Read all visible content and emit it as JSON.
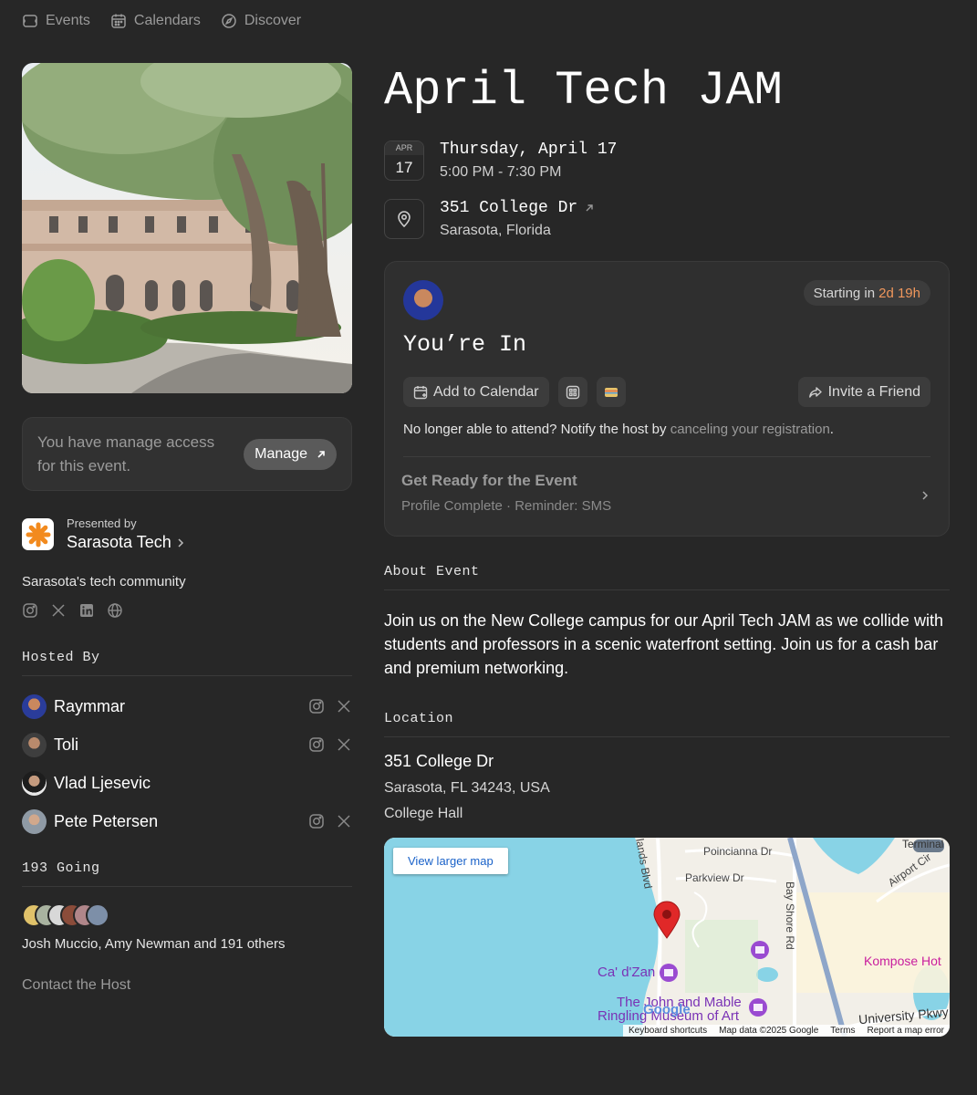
{
  "nav": {
    "events": "Events",
    "calendars": "Calendars",
    "discover": "Discover"
  },
  "manage": {
    "text": "You have manage access for this event.",
    "button": "Manage"
  },
  "presenter": {
    "label": "Presented by",
    "name": "Sarasota Tech",
    "description": "Sarasota's tech community"
  },
  "hosted_by": {
    "title": "Hosted By",
    "hosts": [
      {
        "name": "Raymmar"
      },
      {
        "name": "Toli"
      },
      {
        "name": "Vlad Ljesevic"
      },
      {
        "name": "Pete Petersen"
      }
    ]
  },
  "going": {
    "title": "193 Going",
    "names": "Josh Muccio, Amy Newman and 191 others"
  },
  "contact": "Contact the Host",
  "event": {
    "title": "April Tech JAM",
    "month": "APR",
    "day": "17",
    "date": "Thursday, April 17",
    "time": "5:00 PM - 7:30 PM",
    "address": "351 College Dr",
    "city": "Sarasota, Florida"
  },
  "card": {
    "starting_label": "Starting in",
    "starting_value": "2d 19h",
    "status": "You’re In",
    "add_calendar": "Add to Calendar",
    "invite": "Invite a Friend",
    "cancel_prefix": "No longer able to attend? Notify the host by",
    "cancel_link": "canceling your registration",
    "cancel_suffix": ".",
    "ready_title": "Get Ready for the Event",
    "ready_sub": "Profile Complete · Reminder: SMS"
  },
  "about": {
    "title": "About Event",
    "text": "Join us on the New College campus for our April Tech JAM as we collide with students and professors in a scenic waterfront setting. Join us for a cash bar and premium networking."
  },
  "location": {
    "title": "Location",
    "name": "351 College Dr",
    "address": "Sarasota, FL 34243, USA",
    "place": "College Hall"
  },
  "map": {
    "view_larger": "View larger map",
    "labels": {
      "poinciana": "Poincianna Dr",
      "parkview": "Parkview Dr",
      "lands": "lands Blvd",
      "bayshore": "Bay Shore Rd",
      "airport": "Airport Cir",
      "terminal": "Terminal",
      "kompose": "Kompose Hot",
      "cadzan": "Ca' d'Zan",
      "ringling1": "The John and Mable",
      "ringling2": "Ringling Museum of Art",
      "university": "University Pkwy",
      "google": "Google"
    },
    "footer": [
      "Keyboard shortcuts",
      "Map data ©2025 Google",
      "Terms",
      "Report a map error"
    ]
  }
}
